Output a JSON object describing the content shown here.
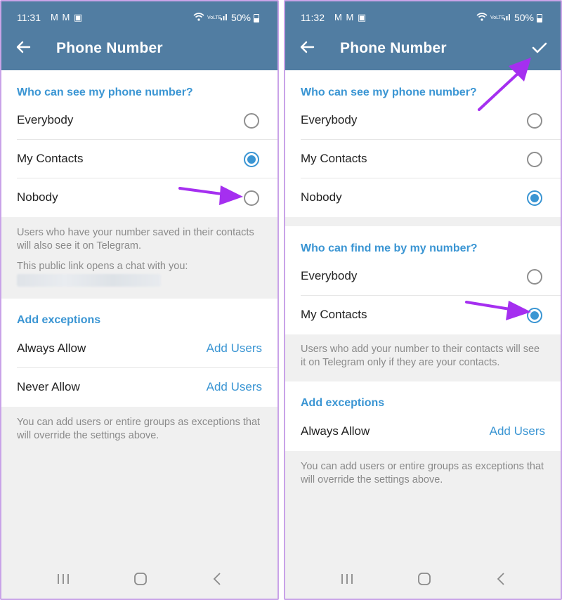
{
  "colors": {
    "header": "#517da2",
    "accent": "#3a95d3",
    "annotation_arrow": "#a52ff0",
    "background": "#f0f0f0"
  },
  "left": {
    "status": {
      "time": "11:31",
      "notif_icons": "M M ▣",
      "network": "VoLTE",
      "battery": "50%"
    },
    "header": {
      "title": "Phone Number",
      "back_icon": "back-arrow-icon"
    },
    "see_section": {
      "title": "Who can see my phone number?",
      "options": [
        "Everybody",
        "My Contacts",
        "Nobody"
      ],
      "selected": "My Contacts"
    },
    "hint1": "Users who have your number saved in their contacts will also see it on Telegram.",
    "hint2": "This public link opens a chat with you:",
    "exceptions": {
      "title": "Add exceptions",
      "rows": [
        {
          "label": "Always Allow",
          "action": "Add Users"
        },
        {
          "label": "Never Allow",
          "action": "Add Users"
        }
      ]
    },
    "footer_hint": "You can add users or entire groups as exceptions that will override the settings above."
  },
  "right": {
    "status": {
      "time": "11:32",
      "notif_icons": "M M ▣",
      "network": "VoLTE",
      "battery": "50%"
    },
    "header": {
      "title": "Phone Number",
      "back_icon": "back-arrow-icon",
      "confirm_icon": "checkmark-icon"
    },
    "see_section": {
      "title": "Who can see my phone number?",
      "options": [
        "Everybody",
        "My Contacts",
        "Nobody"
      ],
      "selected": "Nobody"
    },
    "find_section": {
      "title": "Who can find me by my number?",
      "options": [
        "Everybody",
        "My Contacts"
      ],
      "selected": "My Contacts"
    },
    "hint1": "Users who add your number to their contacts will see it on Telegram only if they are your contacts.",
    "exceptions": {
      "title": "Add exceptions",
      "rows": [
        {
          "label": "Always Allow",
          "action": "Add Users"
        }
      ]
    },
    "footer_hint": "You can add users or entire groups as exceptions that will override the settings above."
  }
}
